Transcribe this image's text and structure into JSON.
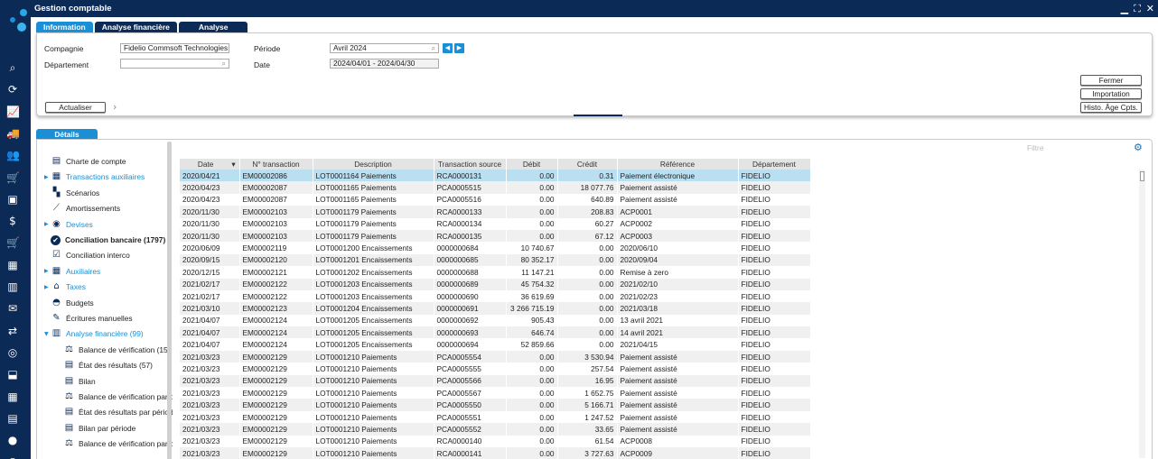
{
  "window": {
    "title": "Gestion comptable"
  },
  "tabs": [
    "Information",
    "Analyse financière",
    "Analyse"
  ],
  "form": {
    "company_label": "Compagnie",
    "company_value": "Fidelio Commsoft Technologies",
    "department_label": "Département",
    "department_value": "",
    "period_label": "Période",
    "period_value": "Avril 2024",
    "date_label": "Date",
    "date_value": "2024/04/01 - 2024/04/30"
  },
  "buttons": {
    "refresh": "Actualiser",
    "close": "Fermer",
    "import": "Importation",
    "history": "Histo. Âge Cpts."
  },
  "details_tab": "Détails",
  "tree": [
    {
      "label": "Charte de compte",
      "icon": "document-icon",
      "arrow": false,
      "style": ""
    },
    {
      "label": "Transactions auxiliaires",
      "icon": "grid-icon",
      "arrow": true,
      "style": "blue"
    },
    {
      "label": "Scénarios",
      "icon": "tiles-icon",
      "arrow": false,
      "style": ""
    },
    {
      "label": "Amortissements",
      "icon": "chart-icon",
      "arrow": false,
      "style": ""
    },
    {
      "label": "Devises",
      "icon": "coins-icon",
      "arrow": true,
      "style": "blue"
    },
    {
      "label": "Conciliation bancaire (1797)",
      "icon": "check-circle-icon",
      "arrow": false,
      "style": "bold"
    },
    {
      "label": "Conciliation interco",
      "icon": "checkbox-icon",
      "arrow": false,
      "style": ""
    },
    {
      "label": "Auxiliaires",
      "icon": "grid-icon",
      "arrow": true,
      "style": "blue"
    },
    {
      "label": "Taxes",
      "icon": "bank-icon",
      "arrow": true,
      "style": "blue"
    },
    {
      "label": "Budgets",
      "icon": "bag-icon",
      "arrow": false,
      "style": ""
    },
    {
      "label": "Écritures manuelles",
      "icon": "pen-icon",
      "arrow": false,
      "style": ""
    },
    {
      "label": "Analyse financière (99)",
      "icon": "analysis-icon",
      "arrow": true,
      "style": "blue"
    },
    {
      "label": "Balance de vérification (153",
      "icon": "scale-icon",
      "arrow": false,
      "style": "",
      "sub": true
    },
    {
      "label": "État des résultats (57)",
      "icon": "report-icon",
      "arrow": false,
      "style": "",
      "sub": true
    },
    {
      "label": "Bilan",
      "icon": "report-icon",
      "arrow": false,
      "style": "",
      "sub": true
    },
    {
      "label": "Balance de vérification par p",
      "icon": "scale-icon",
      "arrow": false,
      "style": "",
      "sub": true
    },
    {
      "label": "État des résultats par périod",
      "icon": "report-icon",
      "arrow": false,
      "style": "",
      "sub": true
    },
    {
      "label": "Bilan par période",
      "icon": "report-icon",
      "arrow": false,
      "style": "",
      "sub": true
    },
    {
      "label": "Balance de vérification par c",
      "icon": "scale-icon",
      "arrow": false,
      "style": "",
      "sub": true
    }
  ],
  "grid": {
    "filter_placeholder": "Filtre",
    "sort_indicator": "▾",
    "columns": [
      "Date",
      "N° transaction",
      "Description",
      "Transaction source",
      "Débit",
      "Crédit",
      "Référence",
      "Département"
    ],
    "rows": [
      [
        "2020/04/21",
        "EM00002086",
        "LOT0001164 Paiements",
        "RCA0000131",
        "0.00",
        "0.31",
        "Paiement électronique",
        "FIDELIO"
      ],
      [
        "2020/04/23",
        "EM00002087",
        "LOT0001165 Paiements",
        "PCA0005515",
        "0.00",
        "18 077.76",
        "Paiement assisté",
        "FIDELIO"
      ],
      [
        "2020/04/23",
        "EM00002087",
        "LOT0001165 Paiements",
        "PCA0005516",
        "0.00",
        "640.89",
        "Paiement assisté",
        "FIDELIO"
      ],
      [
        "2020/11/30",
        "EM00002103",
        "LOT0001179 Paiements",
        "RCA0000133",
        "0.00",
        "208.83",
        "ACP0001",
        "FIDELIO"
      ],
      [
        "2020/11/30",
        "EM00002103",
        "LOT0001179 Paiements",
        "RCA0000134",
        "0.00",
        "60.27",
        "ACP0002",
        "FIDELIO"
      ],
      [
        "2020/11/30",
        "EM00002103",
        "LOT0001179 Paiements",
        "RCA0000135",
        "0.00",
        "67.12",
        "ACP0003",
        "FIDELIO"
      ],
      [
        "2020/06/09",
        "EM00002119",
        "LOT0001200 Encaissements",
        "0000000684",
        "10 740.67",
        "0.00",
        "2020/06/10",
        "FIDELIO"
      ],
      [
        "2020/09/15",
        "EM00002120",
        "LOT0001201 Encaissements",
        "0000000685",
        "80 352.17",
        "0.00",
        "2020/09/04",
        "FIDELIO"
      ],
      [
        "2020/12/15",
        "EM00002121",
        "LOT0001202 Encaissements",
        "0000000688",
        "11 147.21",
        "0.00",
        "Remise à zero",
        "FIDELIO"
      ],
      [
        "2021/02/17",
        "EM00002122",
        "LOT0001203 Encaissements",
        "0000000689",
        "45 754.32",
        "0.00",
        "2021/02/10",
        "FIDELIO"
      ],
      [
        "2021/02/17",
        "EM00002122",
        "LOT0001203 Encaissements",
        "0000000690",
        "36 619.69",
        "0.00",
        "2021/02/23",
        "FIDELIO"
      ],
      [
        "2021/03/10",
        "EM00002123",
        "LOT0001204 Encaissements",
        "0000000691",
        "3 266 715.19",
        "0.00",
        "2021/03/18",
        "FIDELIO"
      ],
      [
        "2021/04/07",
        "EM00002124",
        "LOT0001205 Encaissements",
        "0000000692",
        "905.43",
        "0.00",
        "13 avril 2021",
        "FIDELIO"
      ],
      [
        "2021/04/07",
        "EM00002124",
        "LOT0001205 Encaissements",
        "0000000693",
        "646.74",
        "0.00",
        "14 avril 2021",
        "FIDELIO"
      ],
      [
        "2021/04/07",
        "EM00002124",
        "LOT0001205 Encaissements",
        "0000000694",
        "52 859.66",
        "0.00",
        "2021/04/15",
        "FIDELIO"
      ],
      [
        "2021/03/23",
        "EM00002129",
        "LOT0001210 Paiements",
        "PCA0005554",
        "0.00",
        "3 530.94",
        "Paiement assisté",
        "FIDELIO"
      ],
      [
        "2021/03/23",
        "EM00002129",
        "LOT0001210 Paiements",
        "PCA0005555",
        "0.00",
        "257.54",
        "Paiement assisté",
        "FIDELIO"
      ],
      [
        "2021/03/23",
        "EM00002129",
        "LOT0001210 Paiements",
        "PCA0005566",
        "0.00",
        "16.95",
        "Paiement assisté",
        "FIDELIO"
      ],
      [
        "2021/03/23",
        "EM00002129",
        "LOT0001210 Paiements",
        "PCA0005567",
        "0.00",
        "1 652.75",
        "Paiement assisté",
        "FIDELIO"
      ],
      [
        "2021/03/23",
        "EM00002129",
        "LOT0001210 Paiements",
        "PCA0005550",
        "0.00",
        "5 166.71",
        "Paiement assisté",
        "FIDELIO"
      ],
      [
        "2021/03/23",
        "EM00002129",
        "LOT0001210 Paiements",
        "PCA0005551",
        "0.00",
        "1 247.52",
        "Paiement assisté",
        "FIDELIO"
      ],
      [
        "2021/03/23",
        "EM00002129",
        "LOT0001210 Paiements",
        "PCA0005552",
        "0.00",
        "33.65",
        "Paiement assisté",
        "FIDELIO"
      ],
      [
        "2021/03/23",
        "EM00002129",
        "LOT0001210 Paiements",
        "RCA0000140",
        "0.00",
        "61.54",
        "ACP0008",
        "FIDELIO"
      ],
      [
        "2021/03/23",
        "EM00002129",
        "LOT0001210 Paiements",
        "RCA0000141",
        "0.00",
        "3 727.63",
        "ACP0009",
        "FIDELIO"
      ]
    ],
    "selected_row": 0
  },
  "rail_icons": [
    "search-icon",
    "refresh-icon",
    "chart-icon",
    "truck-icon",
    "users-icon",
    "cart-icon",
    "contact-icon",
    "dollar-icon",
    "basket-icon",
    "org-icon",
    "factory-icon",
    "chat-icon",
    "transfer-icon",
    "coins-icon",
    "inbox-icon",
    "apps-icon",
    "industry-icon",
    "message-icon",
    "bar-chart-icon"
  ]
}
